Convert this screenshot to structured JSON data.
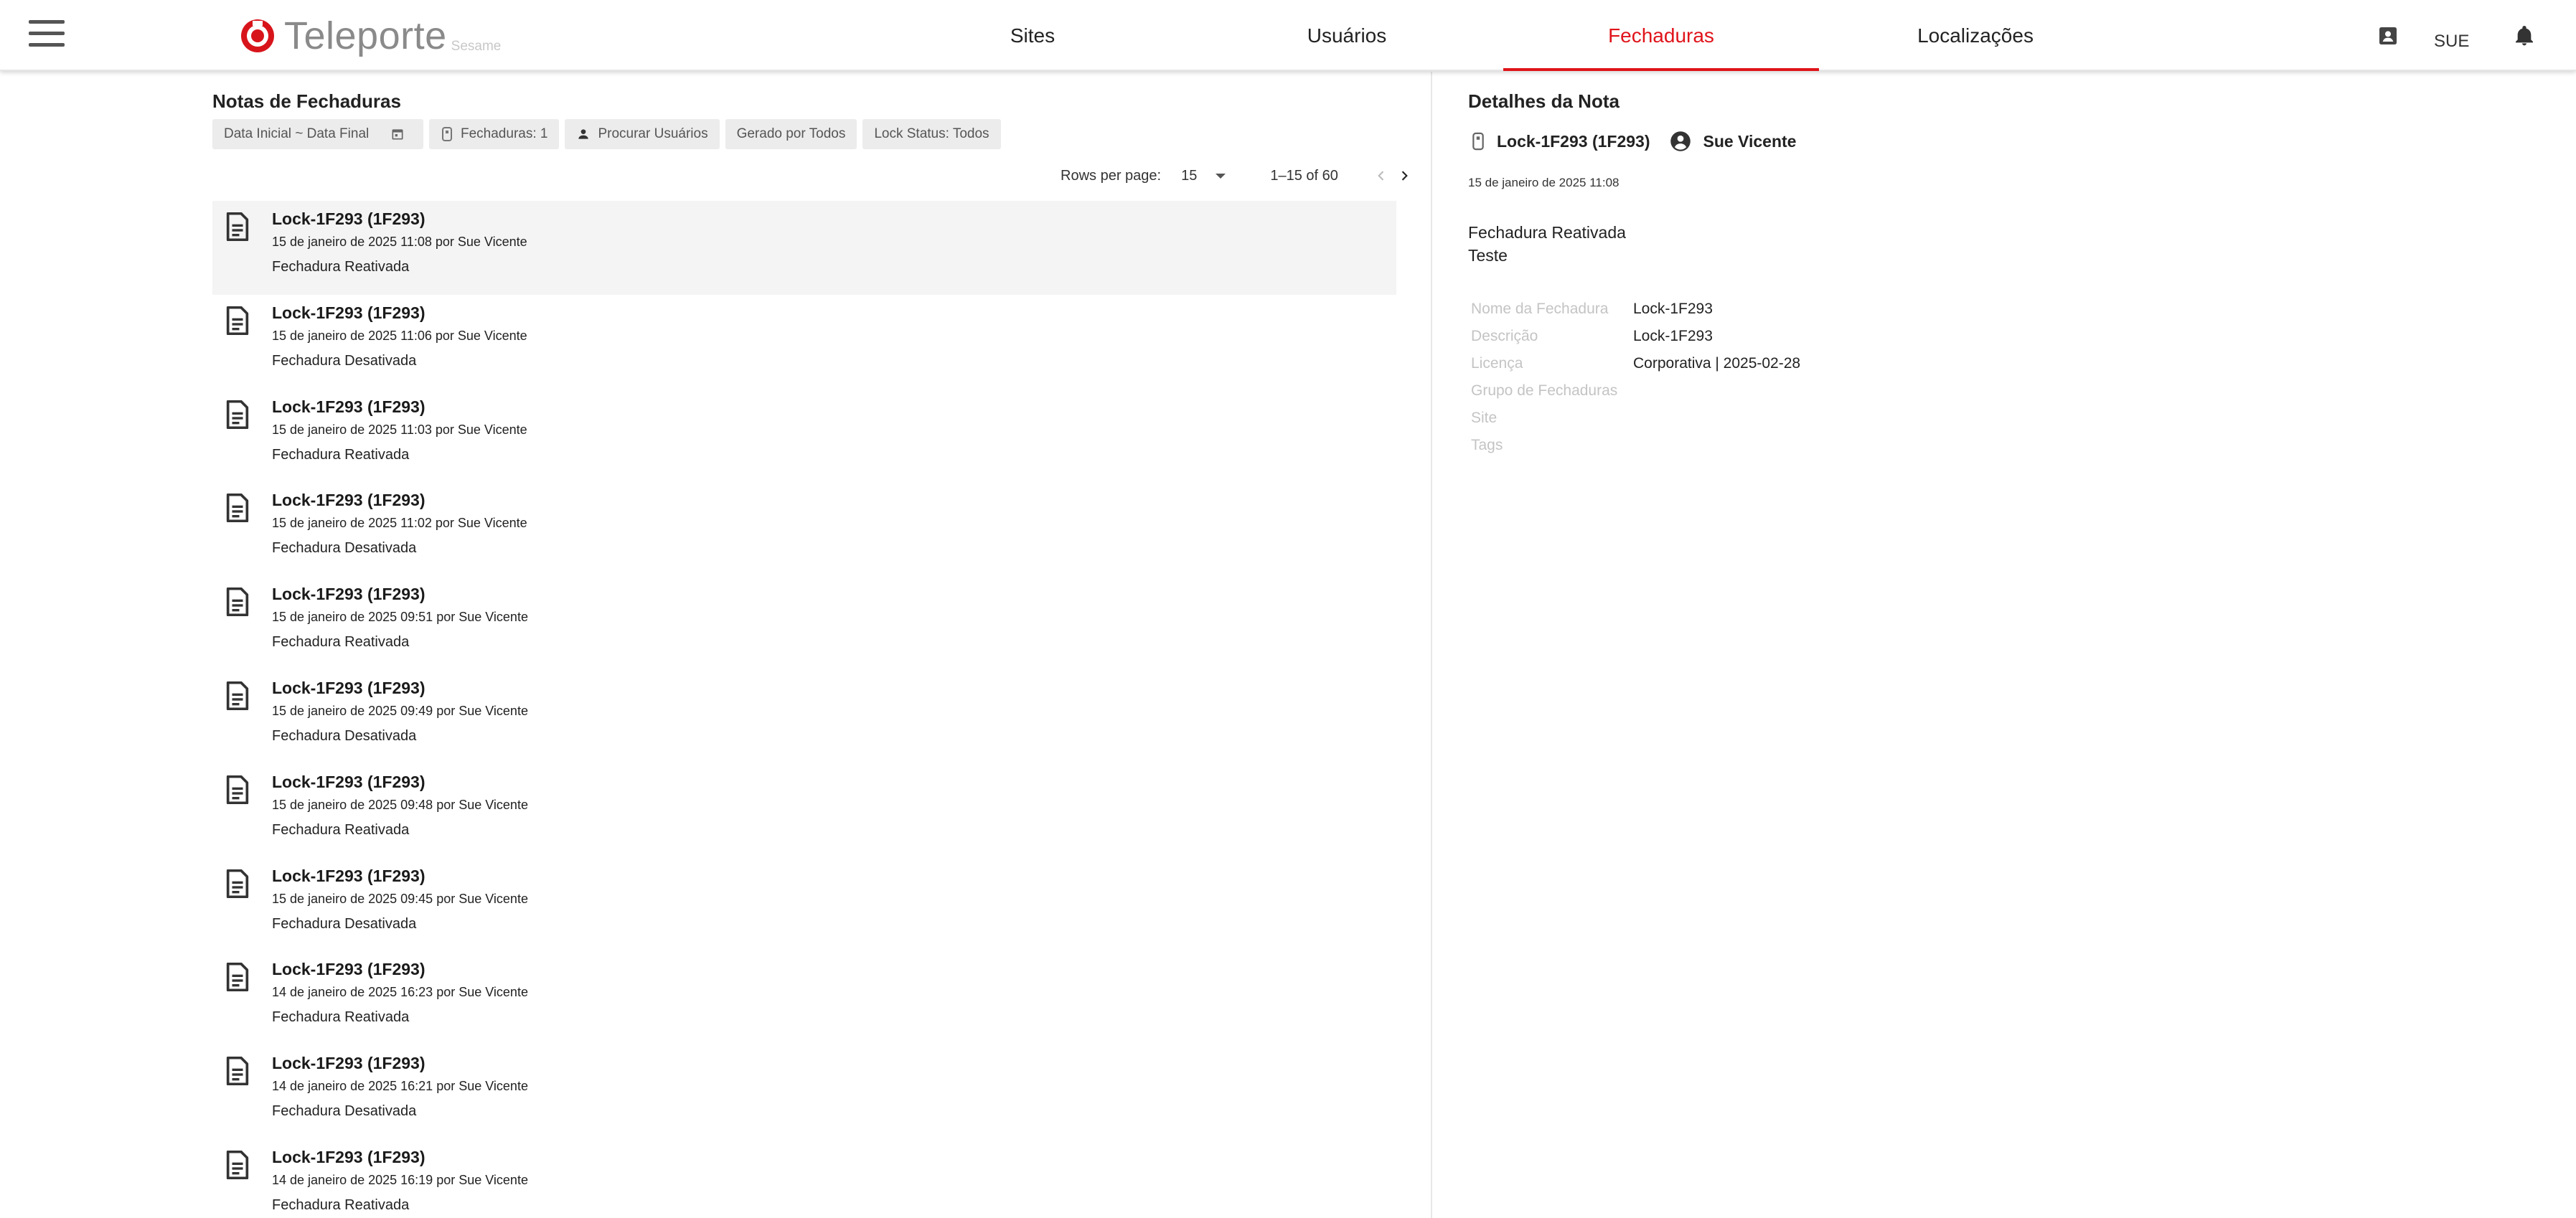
{
  "app": {
    "brand_name": "Teleporte",
    "brand_sub": "Sesame",
    "brand_color": "#e0141b",
    "icons": [
      "menu-icon",
      "teleporte-logo",
      "contact-card-icon",
      "bell-icon"
    ]
  },
  "nav": {
    "tabs": [
      {
        "label": "Sites",
        "active": false
      },
      {
        "label": "Usuários",
        "active": false
      },
      {
        "label": "Fechaduras",
        "active": true
      },
      {
        "label": "Localizações",
        "active": false
      }
    ],
    "user_label": "SUE"
  },
  "notes_panel": {
    "title": "Notas de Fechaduras",
    "filters": {
      "date_range": "Data Inicial ~ Data Final",
      "locks": "Fechaduras: 1",
      "users": "Procurar Usuários",
      "generated_by": "Gerado por Todos",
      "lock_status": "Lock Status: Todos"
    },
    "pagination": {
      "rows_per_page_label": "Rows per page:",
      "rows_per_page": "15",
      "range": "1–15 of 60"
    },
    "notes": [
      {
        "title": "Lock-1F293 (1F293)",
        "meta": "15 de janeiro de 2025 11:08 por Sue Vicente",
        "status": "Fechadura Reativada"
      },
      {
        "title": "Lock-1F293 (1F293)",
        "meta": "15 de janeiro de 2025 11:06 por Sue Vicente",
        "status": "Fechadura Desativada"
      },
      {
        "title": "Lock-1F293 (1F293)",
        "meta": "15 de janeiro de 2025 11:03 por Sue Vicente",
        "status": "Fechadura Reativada"
      },
      {
        "title": "Lock-1F293 (1F293)",
        "meta": "15 de janeiro de 2025 11:02 por Sue Vicente",
        "status": "Fechadura Desativada"
      },
      {
        "title": "Lock-1F293 (1F293)",
        "meta": "15 de janeiro de 2025 09:51 por Sue Vicente",
        "status": "Fechadura Reativada"
      },
      {
        "title": "Lock-1F293 (1F293)",
        "meta": "15 de janeiro de 2025 09:49 por Sue Vicente",
        "status": "Fechadura Desativada"
      },
      {
        "title": "Lock-1F293 (1F293)",
        "meta": "15 de janeiro de 2025 09:48 por Sue Vicente",
        "status": "Fechadura Reativada"
      },
      {
        "title": "Lock-1F293 (1F293)",
        "meta": "15 de janeiro de 2025 09:45 por Sue Vicente",
        "status": "Fechadura Desativada"
      },
      {
        "title": "Lock-1F293 (1F293)",
        "meta": "14 de janeiro de 2025 16:23 por Sue Vicente",
        "status": "Fechadura Reativada"
      },
      {
        "title": "Lock-1F293 (1F293)",
        "meta": "14 de janeiro de 2025 16:21 por Sue Vicente",
        "status": "Fechadura Desativada"
      },
      {
        "title": "Lock-1F293 (1F293)",
        "meta": "14 de janeiro de 2025 16:19 por Sue Vicente",
        "status": "Fechadura Reativada"
      }
    ]
  },
  "details": {
    "title": "Detalhes da Nota",
    "lock": "Lock-1F293 (1F293)",
    "user": "Sue Vicente",
    "date": "15 de janeiro de 2025 11:08",
    "body_line1": "Fechadura Reativada",
    "body_line2": "Teste",
    "properties": [
      {
        "key": "Nome da Fechadura",
        "value": "Lock-1F293"
      },
      {
        "key": "Descrição",
        "value": "Lock-1F293"
      },
      {
        "key": "Licença",
        "value": "Corporativa | 2025-02-28"
      },
      {
        "key": "Grupo de Fechaduras",
        "value": ""
      },
      {
        "key": "Site",
        "value": ""
      },
      {
        "key": "Tags",
        "value": ""
      }
    ]
  }
}
